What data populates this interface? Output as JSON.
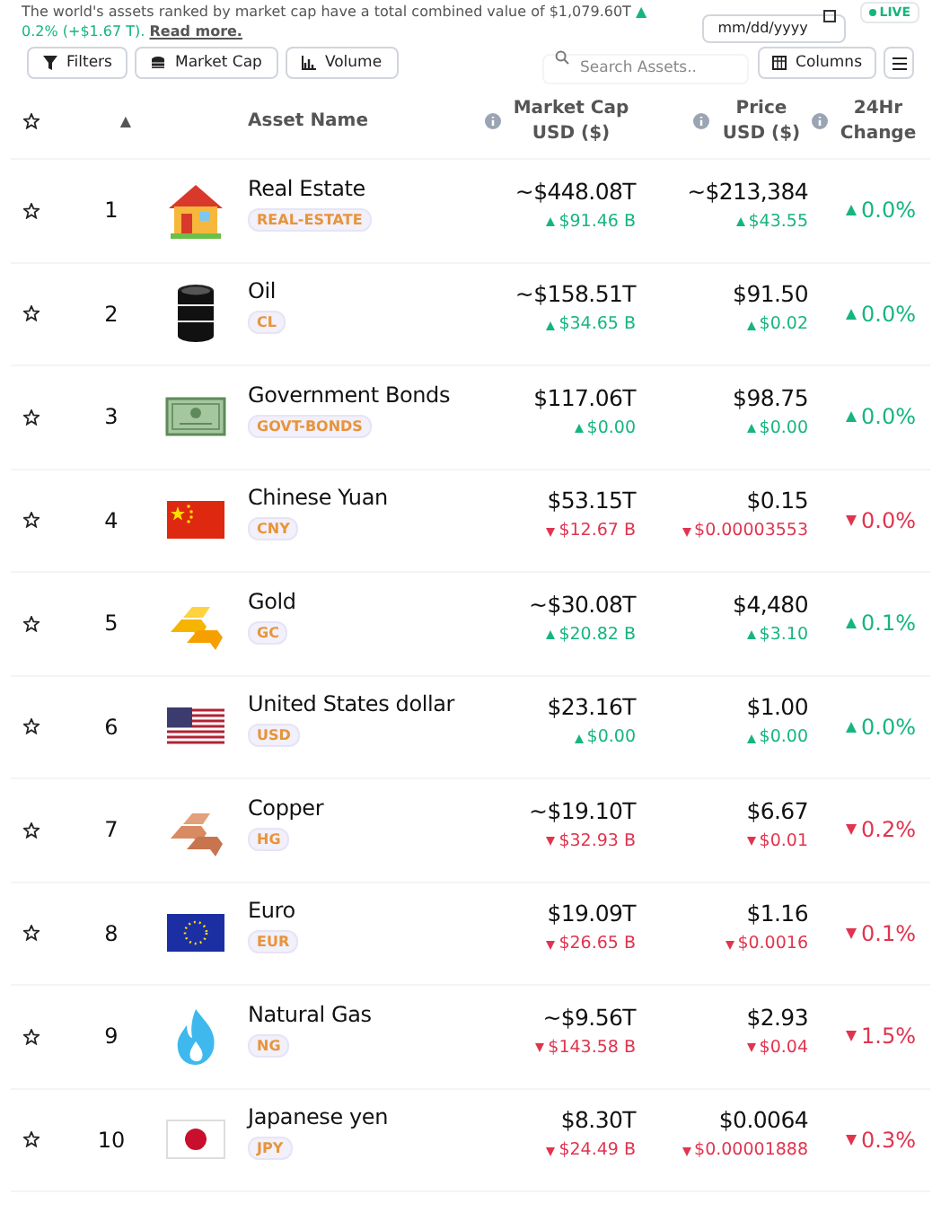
{
  "summary": {
    "text": "The world's assets ranked by market cap have a total combined value of $1,079.60T",
    "change": "▲ 0.2% (+$1.67 T).",
    "link": "Read more."
  },
  "date_field": {
    "placeholder": "mm/dd/yyyy"
  },
  "live": {
    "label": "LIVE",
    "on": true
  },
  "toolbar": {
    "buttons": [
      {
        "label": "Filters",
        "kind": "filter"
      },
      {
        "label": "Market Cap",
        "kind": "coins"
      },
      {
        "label": "Volume",
        "kind": "chart"
      }
    ],
    "search": {
      "placeholder": "Search Assets.."
    },
    "columns_button": "Columns"
  },
  "table": {
    "columns": [
      {
        "label": "▲"
      },
      {
        "label": "Asset Name"
      },
      {
        "label": "Market Cap USD ($)"
      },
      {
        "label": "Price USD ($)"
      },
      {
        "label": "24Hr Change"
      }
    ],
    "rows": [
      {
        "starred": false,
        "rank": "1",
        "kind": "house",
        "name": "Real Estate",
        "ticker": "REAL-ESTATE",
        "market_cap": "~$448.08T",
        "market_cap_change": "$91.46 B",
        "market_cap_up": true,
        "price": "~$213,384",
        "price_change": "$43.55",
        "price_up": true,
        "change": "0.0%",
        "change_up": true
      },
      {
        "starred": false,
        "rank": "2",
        "kind": "barrel",
        "name": "Oil",
        "ticker": "CL",
        "market_cap": "~$158.51T",
        "market_cap_change": "$34.65 B",
        "market_cap_up": true,
        "price": "$91.50",
        "price_change": "$0.02",
        "price_up": true,
        "change": "0.0%",
        "change_up": true
      },
      {
        "starred": false,
        "rank": "3",
        "kind": "bond",
        "name": "Government Bonds",
        "ticker": "GOVT-BONDS",
        "market_cap": "$117.06T",
        "market_cap_change": "$0.00",
        "market_cap_up": true,
        "price": "$98.75",
        "price_change": "$0.00",
        "price_up": true,
        "change": "0.0%",
        "change_up": true
      },
      {
        "starred": false,
        "rank": "4",
        "kind": "flag-cn",
        "name": "Chinese Yuan",
        "ticker": "CNY",
        "market_cap": "$53.15T",
        "market_cap_change": "$12.67 B",
        "market_cap_up": false,
        "price": "$0.15",
        "price_change": "$0.00003553",
        "price_up": false,
        "change": "0.0%",
        "change_up": false
      },
      {
        "starred": false,
        "rank": "5",
        "kind": "gold",
        "name": "Gold",
        "ticker": "GC",
        "market_cap": "~$30.08T",
        "market_cap_change": "$20.82 B",
        "market_cap_up": true,
        "price": "$4,480",
        "price_change": "$3.10",
        "price_up": true,
        "change": "0.1%",
        "change_up": true
      },
      {
        "starred": false,
        "rank": "6",
        "kind": "flag-us",
        "name": "United States dollar",
        "ticker": "USD",
        "market_cap": "$23.16T",
        "market_cap_change": "$0.00",
        "market_cap_up": true,
        "price": "$1.00",
        "price_change": "$0.00",
        "price_up": true,
        "change": "0.0%",
        "change_up": true
      },
      {
        "starred": false,
        "rank": "7",
        "kind": "copper",
        "name": "Copper",
        "ticker": "HG",
        "market_cap": "~$19.10T",
        "market_cap_change": "$32.93 B",
        "market_cap_up": false,
        "price": "$6.67",
        "price_change": "$0.01",
        "price_up": false,
        "change": "0.2%",
        "change_up": false
      },
      {
        "starred": false,
        "rank": "8",
        "kind": "flag-eu",
        "name": "Euro",
        "ticker": "EUR",
        "market_cap": "$19.09T",
        "market_cap_change": "$26.65 B",
        "market_cap_up": false,
        "price": "$1.16",
        "price_change": "$0.0016",
        "price_up": false,
        "change": "0.1%",
        "change_up": false
      },
      {
        "starred": false,
        "rank": "9",
        "kind": "flame",
        "name": "Natural Gas",
        "ticker": "NG",
        "market_cap": "~$9.56T",
        "market_cap_change": "$143.58 B",
        "market_cap_up": false,
        "price": "$2.93",
        "price_change": "$0.04",
        "price_up": false,
        "change": "1.5%",
        "change_up": false
      },
      {
        "starred": false,
        "rank": "10",
        "kind": "flag-jp",
        "name": "Japanese yen",
        "ticker": "JPY",
        "market_cap": "$8.30T",
        "market_cap_change": "$24.49 B",
        "market_cap_up": false,
        "price": "$0.0064",
        "price_change": "$0.00001888",
        "price_up": false,
        "change": "0.3%",
        "change_up": false
      }
    ]
  }
}
